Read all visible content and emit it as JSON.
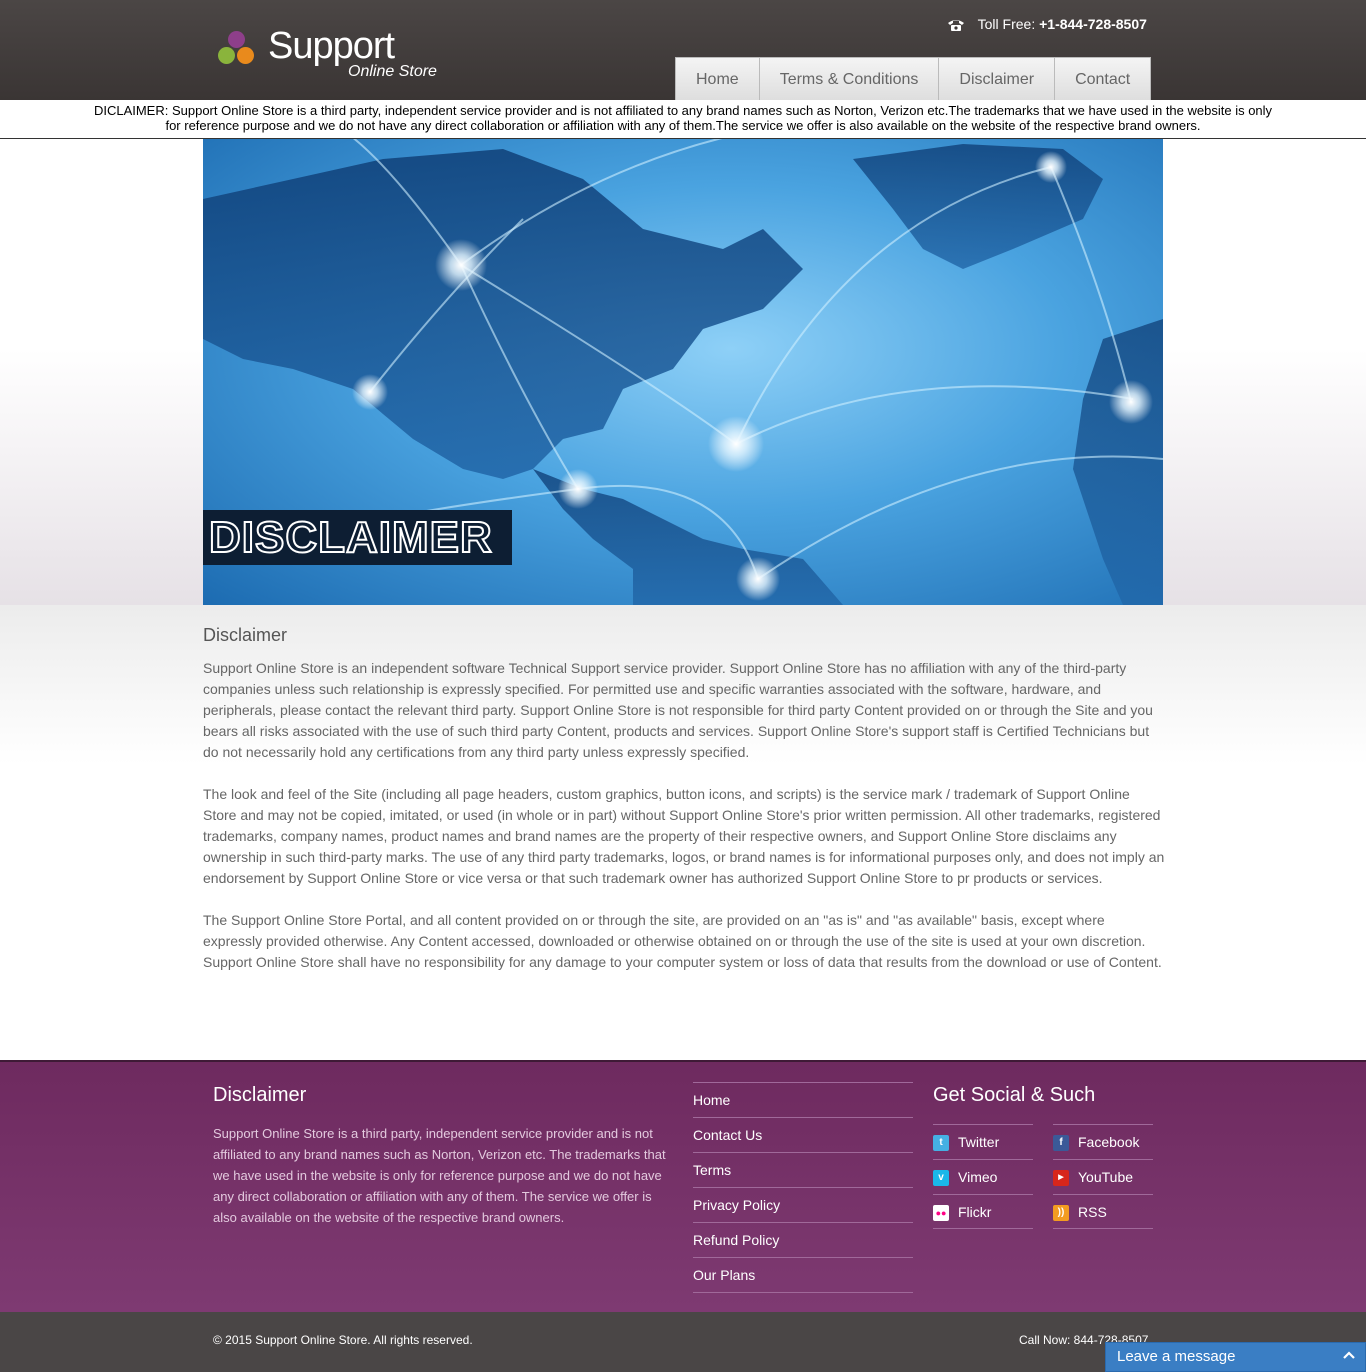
{
  "header": {
    "logo_main": "Support",
    "logo_sub": "Online Store",
    "tollfree_label": "Toll Free:",
    "tollfree_number": "+1-844-728-8507",
    "nav": [
      {
        "label": "Home"
      },
      {
        "label": "Terms & Conditions"
      },
      {
        "label": "Disclaimer"
      },
      {
        "label": "Contact"
      }
    ]
  },
  "top_disclaimer": "DICLAIMER: Support Online Store is a third party, independent service provider and is not affiliated to any brand names such as Norton, Verizon etc.The trademarks that we have used in the website is only for reference purpose and we do not have any direct collaboration or affiliation with any of them.The service we offer is also available on the website of the respective brand owners.",
  "banner": {
    "label": "DISCLAIMER"
  },
  "content": {
    "title": "Disclaimer",
    "paragraphs": [
      "Support Online Store is an independent software Technical Support service provider. Support Online Store has no affiliation with any of the third-party companies unless such relationship is expressly specified. For permitted use and specific warranties associated with the software, hardware, and peripherals, please contact the relevant third party. Support Online Store is not responsible for third party Content provided on or through the Site and you bears all risks associated with the use of such third party Content, products and services. Support Online Store's support staff is Certified Technicians but do not necessarily hold any certifications from any third party unless expressly specified.",
      "The look and feel of the Site (including all page headers, custom graphics, button icons, and scripts) is the service mark / trademark of Support Online Store and may not be copied, imitated, or used (in whole or in part) without Support Online Store's prior written permission. All other trademarks, registered trademarks, company names, product names and brand names are the property of their respective owners, and Support Online Store disclaims any ownership in such third-party marks. The use of any third party trademarks, logos, or brand names is for informational purposes only, and does not imply an endorsement by Support Online Store or vice versa or that such trademark owner has authorized Support Online Store to pr products or services.",
      "The Support Online Store Portal, and all content provided on or through the site, are provided on an \"as is\" and \"as available\" basis, except where expressly provided otherwise. Any Content accessed, downloaded or otherwise obtained on or through the use of the site is used at your own discretion. Support Online Store shall have no responsibility for any damage to your computer system or loss of data that results from the download or use of Content."
    ]
  },
  "footer": {
    "disclaimer_title": "Disclaimer",
    "disclaimer_text": "Support Online Store is a third party, independent service provider and is not affiliated to any brand names such as Norton, Verizon etc. The trademarks that we have used in the website is only for reference purpose and we do not have any direct collaboration or affiliation with any of them. The service we offer is also available on the website of the respective brand owners.",
    "links": [
      {
        "label": "Home"
      },
      {
        "label": "Contact Us"
      },
      {
        "label": "Terms"
      },
      {
        "label": "Privacy Policy"
      },
      {
        "label": "Refund Policy"
      },
      {
        "label": "Our Plans"
      }
    ],
    "social_title": "Get Social & Such",
    "social": [
      {
        "label": "Twitter",
        "icon": "twitter-icon"
      },
      {
        "label": "Facebook",
        "icon": "facebook-icon"
      },
      {
        "label": "Vimeo",
        "icon": "vimeo-icon"
      },
      {
        "label": "YouTube",
        "icon": "youtube-icon"
      },
      {
        "label": "Flickr",
        "icon": "flickr-icon"
      },
      {
        "label": "RSS",
        "icon": "rss-icon"
      }
    ]
  },
  "bottom": {
    "copyright": "© 2015 Support Online Store. All rights reserved.",
    "callnow": "Call Now: 844-728-8507"
  },
  "chat": {
    "label": "Leave a message"
  }
}
